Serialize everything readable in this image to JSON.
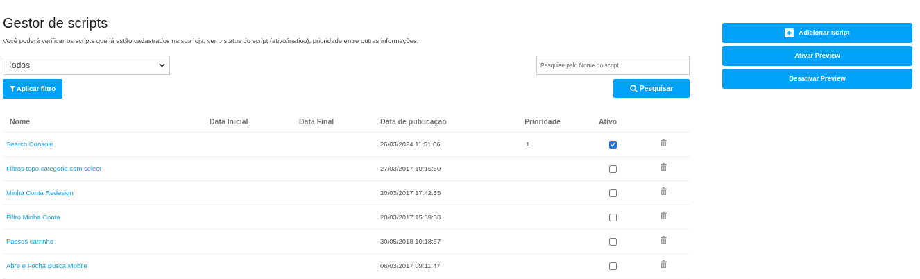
{
  "header": {
    "title": "Gestor de scripts",
    "description": "Você poderá verificar os scripts que já estão cadastrados na sua loja, ver o status do script (ativo/inativo), prioridade entre outras informações."
  },
  "filter": {
    "select_value": "Todos",
    "apply_button": "Aplicar filtro"
  },
  "search": {
    "placeholder": "Pesquise pelo Nome do script",
    "button": "Pesquisar"
  },
  "actions": [
    "Adicionar Script",
    "Ativar Preview",
    "Desativar Preview"
  ],
  "table": {
    "columns": [
      "Nome",
      "Data Inicial",
      "Data Final",
      "Data de publicação",
      "Prioridade",
      "Ativo"
    ],
    "rows": [
      {
        "name": "Search Console",
        "published": "26/03/2024 11:51:06",
        "priority": "1",
        "checked": true
      },
      {
        "name": "Filtros topo categoria com select",
        "published": "27/03/2017 10:15:50",
        "checked": false
      },
      {
        "name": "Minha Conta Redesign",
        "published": "20/03/2017 17:42:55",
        "checked": false
      },
      {
        "name": "Filtro Minha Conta",
        "published": "20/03/2017 15:39:38",
        "checked": false
      },
      {
        "name": "Passos carrinho",
        "published": "30/05/2018 10:18:57",
        "checked": false
      },
      {
        "name": "Abre e Fecha Busca Mobile",
        "published": "06/03/2017 09:11:47",
        "checked": false
      }
    ]
  }
}
